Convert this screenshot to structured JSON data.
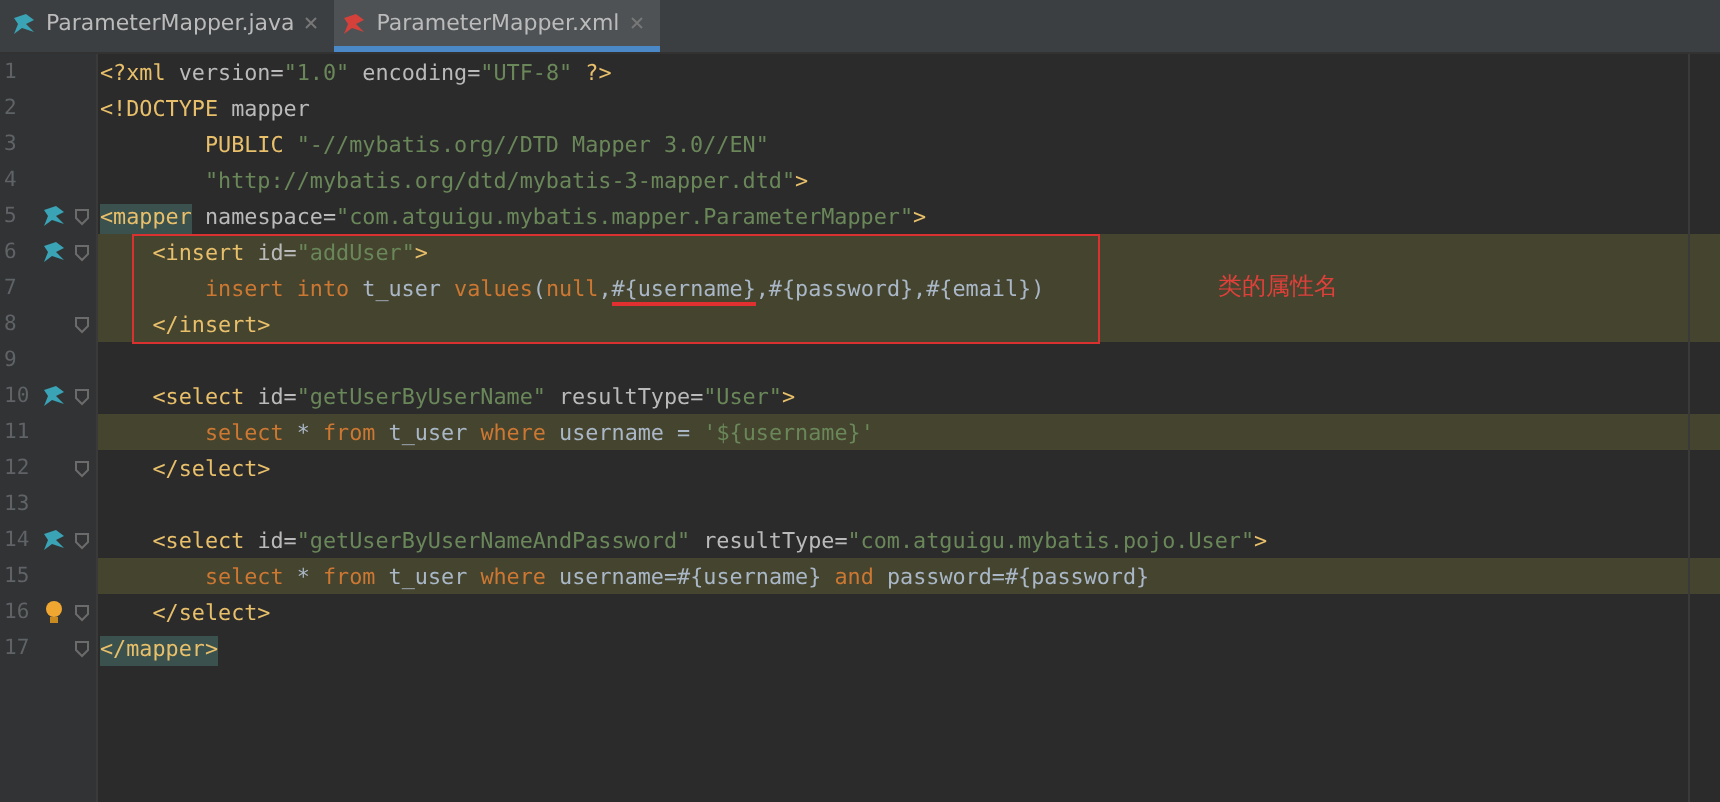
{
  "tabs": [
    {
      "label": "ParameterMapper.java",
      "selected": false
    },
    {
      "label": "ParameterMapper.xml",
      "selected": true
    }
  ],
  "editor": {
    "lines": [
      {
        "number": "1",
        "highlight": false,
        "fold": false,
        "tokens": [
          {
            "kind": "tag",
            "text": "<?xml "
          },
          {
            "kind": "attr",
            "text": "version="
          },
          {
            "kind": "value",
            "text": "\"1.0\" "
          },
          {
            "kind": "attr",
            "text": "encoding="
          },
          {
            "kind": "value",
            "text": "\"UTF-8\" "
          },
          {
            "kind": "tag",
            "text": "?>"
          }
        ]
      },
      {
        "number": "2",
        "highlight": false,
        "fold": false,
        "tokens": [
          {
            "kind": "tag",
            "text": "<!DOCTYPE "
          },
          {
            "kind": "attr",
            "text": "mapper"
          }
        ]
      },
      {
        "number": "3",
        "highlight": false,
        "fold": false,
        "tokens": [
          {
            "kind": "tag",
            "text": "        PUBLIC "
          },
          {
            "kind": "value",
            "text": "\"-//mybatis.org//DTD Mapper 3.0//EN\""
          }
        ]
      },
      {
        "number": "4",
        "highlight": false,
        "fold": false,
        "tokens": [
          {
            "kind": "value",
            "text": "        \"http://mybatis.org/dtd/mybatis-3-mapper.dtd\""
          },
          {
            "kind": "tag",
            "text": ">"
          }
        ]
      },
      {
        "number": "5",
        "highlight": false,
        "fold": true,
        "kind": "mapper",
        "tokens": [
          {
            "kind": "tag",
            "text": "<mapper",
            "matched": true
          },
          {
            "kind": "attr",
            "text": " namespace="
          },
          {
            "kind": "value",
            "text": "\"com.atguigu.mybatis.mapper.ParameterMapper\""
          },
          {
            "kind": "tag",
            "text": ">"
          }
        ]
      },
      {
        "number": "6",
        "highlight": true,
        "fold": true,
        "kind": "mapper",
        "tokens": [
          {
            "kind": "tag",
            "text": "    <insert "
          },
          {
            "kind": "attr",
            "text": "id="
          },
          {
            "kind": "value",
            "text": "\"addUser\""
          },
          {
            "kind": "tag",
            "text": ">"
          }
        ]
      },
      {
        "number": "7",
        "highlight": true,
        "fold": false,
        "tokens": [
          {
            "kind": "kw",
            "text": "        insert into "
          },
          {
            "kind": "text",
            "text": "t_user "
          },
          {
            "kind": "kw",
            "text": "values"
          },
          {
            "kind": "text",
            "text": "("
          },
          {
            "kind": "kw",
            "text": "null"
          },
          {
            "kind": "text",
            "text": ","
          },
          {
            "kind": "text",
            "text": "#{username}",
            "underlined": true
          },
          {
            "kind": "text",
            "text": ",#{password},#{email})"
          }
        ]
      },
      {
        "number": "8",
        "highlight": true,
        "fold": true,
        "tokens": [
          {
            "kind": "tag",
            "text": "    </insert>"
          }
        ]
      },
      {
        "number": "9",
        "highlight": false,
        "fold": false
      },
      {
        "number": "10",
        "highlight": false,
        "fold": true,
        "kind": "mapper",
        "tokens": [
          {
            "kind": "tag",
            "text": "    <select "
          },
          {
            "kind": "attr",
            "text": "id="
          },
          {
            "kind": "value",
            "text": "\"getUserByUserName\" "
          },
          {
            "kind": "attr",
            "text": "resultType="
          },
          {
            "kind": "value",
            "text": "\"User\""
          },
          {
            "kind": "tag",
            "text": ">"
          }
        ]
      },
      {
        "number": "11",
        "highlight": true,
        "fold": false,
        "tokens": [
          {
            "kind": "kw",
            "text": "        select "
          },
          {
            "kind": "text",
            "text": "* "
          },
          {
            "kind": "kw",
            "text": "from "
          },
          {
            "kind": "text",
            "text": "t_user "
          },
          {
            "kind": "kw",
            "text": "where "
          },
          {
            "kind": "text",
            "text": "username = "
          },
          {
            "kind": "value",
            "text": "'${username}'"
          }
        ]
      },
      {
        "number": "12",
        "highlight": false,
        "fold": true,
        "tokens": [
          {
            "kind": "tag",
            "text": "    </select>"
          }
        ]
      },
      {
        "number": "13",
        "highlight": false,
        "fold": false
      },
      {
        "number": "14",
        "highlight": false,
        "fold": true,
        "kind": "mapper",
        "tokens": [
          {
            "kind": "tag",
            "text": "    <select "
          },
          {
            "kind": "attr",
            "text": "id="
          },
          {
            "kind": "value",
            "text": "\"getUserByUserNameAndPassword\" "
          },
          {
            "kind": "attr",
            "text": "resultType="
          },
          {
            "kind": "value",
            "text": "\"com.atguigu.mybatis.pojo.User\""
          },
          {
            "kind": "tag",
            "text": ">"
          }
        ]
      },
      {
        "number": "15",
        "highlight": true,
        "fold": false,
        "tokens": [
          {
            "kind": "kw",
            "text": "        select "
          },
          {
            "kind": "text",
            "text": "* "
          },
          {
            "kind": "kw",
            "text": "from "
          },
          {
            "kind": "text",
            "text": "t_user "
          },
          {
            "kind": "kw",
            "text": "where "
          },
          {
            "kind": "text",
            "text": "username=#{username} "
          },
          {
            "kind": "kw",
            "text": "and "
          },
          {
            "kind": "text",
            "text": "password=#{password}"
          }
        ]
      },
      {
        "number": "16",
        "highlight": false,
        "fold": true,
        "kind": "bulb",
        "tokens": [
          {
            "kind": "tag",
            "text": "    </select>"
          }
        ]
      },
      {
        "number": "17",
        "highlight": false,
        "fold": true,
        "tokens": [
          {
            "kind": "tag",
            "text": "</mapper>",
            "matched": true
          }
        ]
      }
    ]
  },
  "annotation": {
    "label": "类的属性名"
  }
}
